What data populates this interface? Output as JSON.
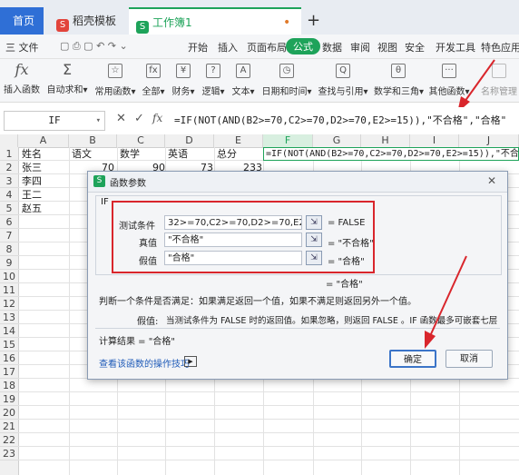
{
  "tabs": {
    "home": "首页",
    "template": "稻壳模板",
    "workbook": "工作簿1",
    "dot": "•",
    "close": "×",
    "add": "+"
  },
  "menubar": {
    "file": "三 文件",
    "items": [
      "开始",
      "插入",
      "页面布局",
      "公式",
      "数据",
      "审阅",
      "视图",
      "安全",
      "开发工具",
      "特色应用"
    ]
  },
  "ribbon": {
    "items": [
      "插入函数",
      "自动求和",
      "常用函数",
      "全部",
      "财务",
      "逻辑",
      "文本",
      "日期和时间",
      "查找与引用",
      "数学和三角",
      "其他函数",
      "名称管理"
    ],
    "glyphs": [
      "fx",
      "Σ",
      "☆",
      "fx",
      "¥",
      "?",
      "A",
      "◷",
      "Q",
      "θ",
      "···",
      ""
    ]
  },
  "formula_bar": {
    "name_box": "IF",
    "formula": "=IF(NOT(AND(B2>=70,C2>=70,D2>=70,E2>=15)),\"不合格\",\"合格\""
  },
  "grid": {
    "columns": [
      "A",
      "B",
      "C",
      "D",
      "E",
      "F",
      "G",
      "H",
      "I",
      "J"
    ],
    "rows": [
      "1",
      "2",
      "3",
      "4",
      "5",
      "6",
      "7",
      "8",
      "9",
      "10",
      "11",
      "12",
      "13",
      "14",
      "15",
      "16",
      "17",
      "18",
      "19",
      "20",
      "21",
      "22",
      "23"
    ],
    "header_row": [
      "姓名",
      "语文",
      "数学",
      "英语",
      "总分"
    ],
    "names": [
      "张三",
      "李四",
      "王二",
      "赵五"
    ],
    "row2_values": [
      "70",
      "90",
      "73",
      "233"
    ],
    "f1_formula": "=IF(NOT(AND(B2>=70,C2>=70,D2>=70,E2>=15)),\"不合格\",\"合格\""
  },
  "dialog": {
    "title": "函数参数",
    "group": "IF",
    "args": [
      {
        "label": "测试条件",
        "value": "32>=70,C2>=70,D2>=70,E2>=15))",
        "result": "= FALSE"
      },
      {
        "label": "真值",
        "value": "\"不合格\"",
        "result": "= \"不合格\""
      },
      {
        "label": "假值",
        "value": "\"合格\"",
        "result": "= \"合格\""
      }
    ],
    "overall_result": "= \"合格\"",
    "description": "判断一个条件是否满足：如果满足返回一个值，如果不满足则返回另外一个值。",
    "arg_help_label": "假值:",
    "arg_help": "当测试条件为 FALSE 时的返回值。如果忽略，则返回 FALSE 。IF 函数最多可嵌套七层",
    "calc_result": "计算结果 = \"合格\"",
    "help_link": "查看该函数的操作技巧",
    "ok": "确定",
    "cancel": "取消"
  },
  "colors": {
    "accent_green": "#1ea35a",
    "home_blue": "#2f6fd6",
    "annotation_red": "#d9262c"
  }
}
